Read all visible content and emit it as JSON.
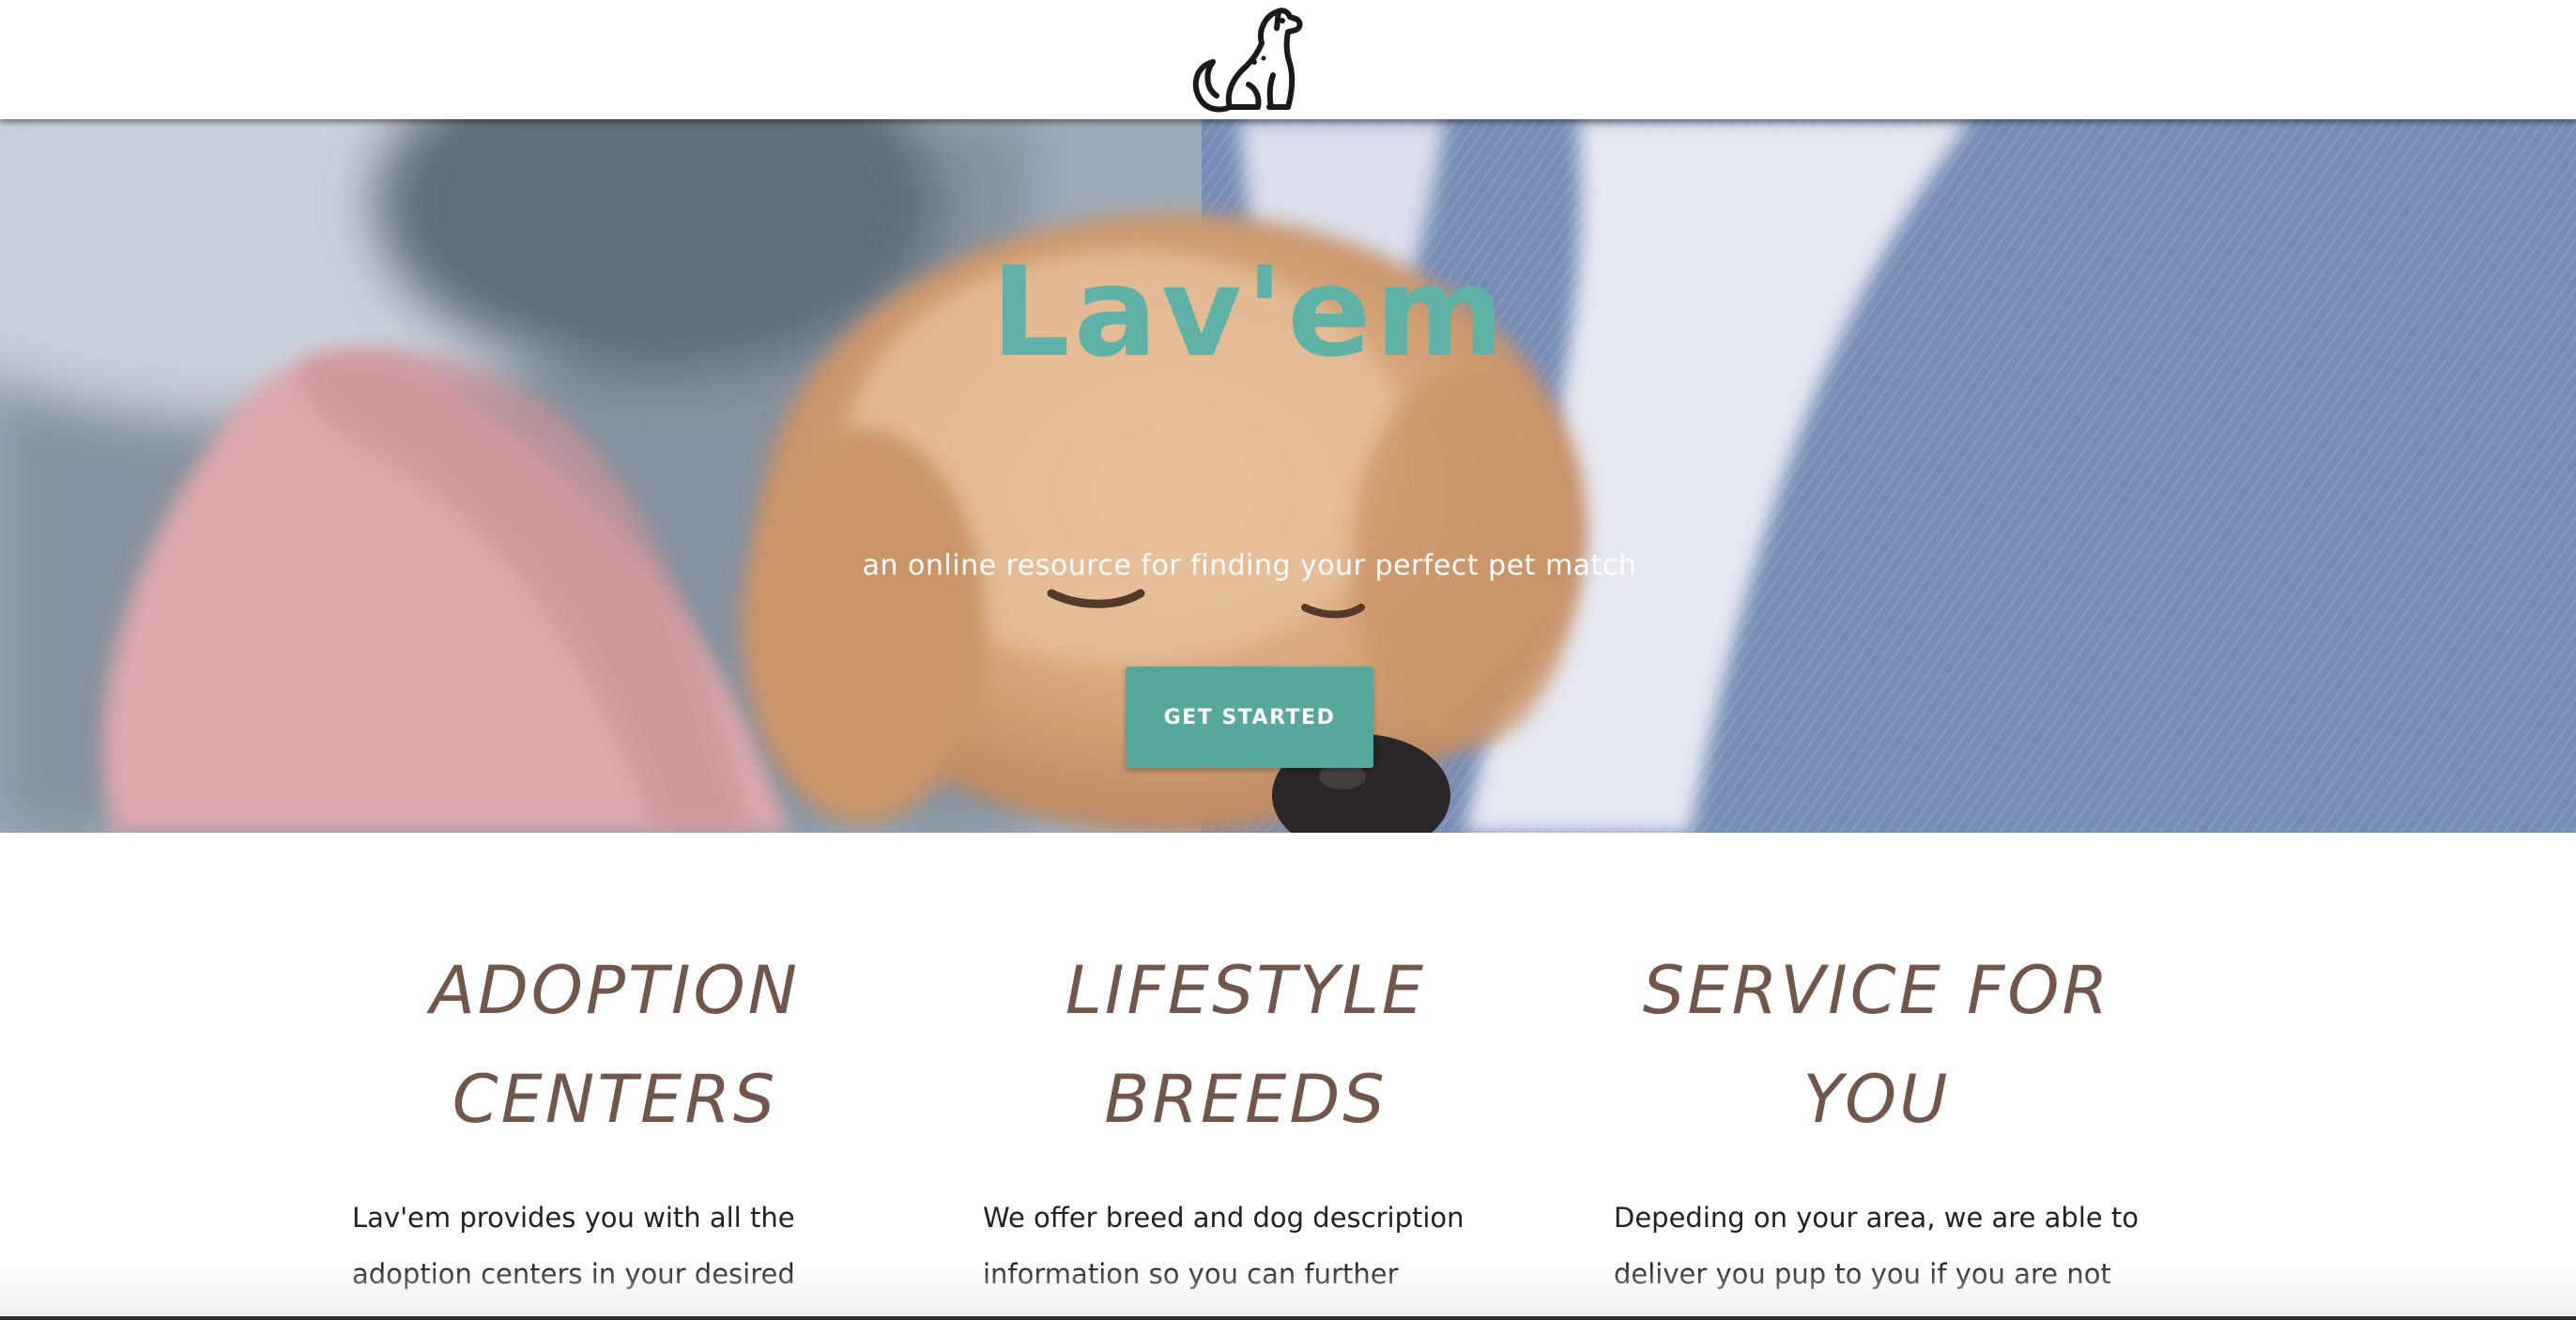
{
  "header": {
    "logo_icon": "dog-sitting-icon"
  },
  "hero": {
    "title": "Lav'em",
    "subtitle": "an online resource for finding your perfect pet match",
    "cta_label": "GET STARTED",
    "background": "puppy-sleeping-in-arms-photo"
  },
  "features": [
    {
      "title": "ADOPTION CENTERS",
      "text": "Lav'em provides you with all the adoption centers in your desired"
    },
    {
      "title": "LIFESTYLE BREEDS",
      "text": "We offer breed and dog description information so you can further connect"
    },
    {
      "title": "SERVICE FOR YOU",
      "text": "Depeding on your area, we are able to deliver you pup to you if you are not"
    }
  ],
  "colors": {
    "accent": "#5fb3a6",
    "button": "#56a89c",
    "heading_brown": "#72564a"
  }
}
